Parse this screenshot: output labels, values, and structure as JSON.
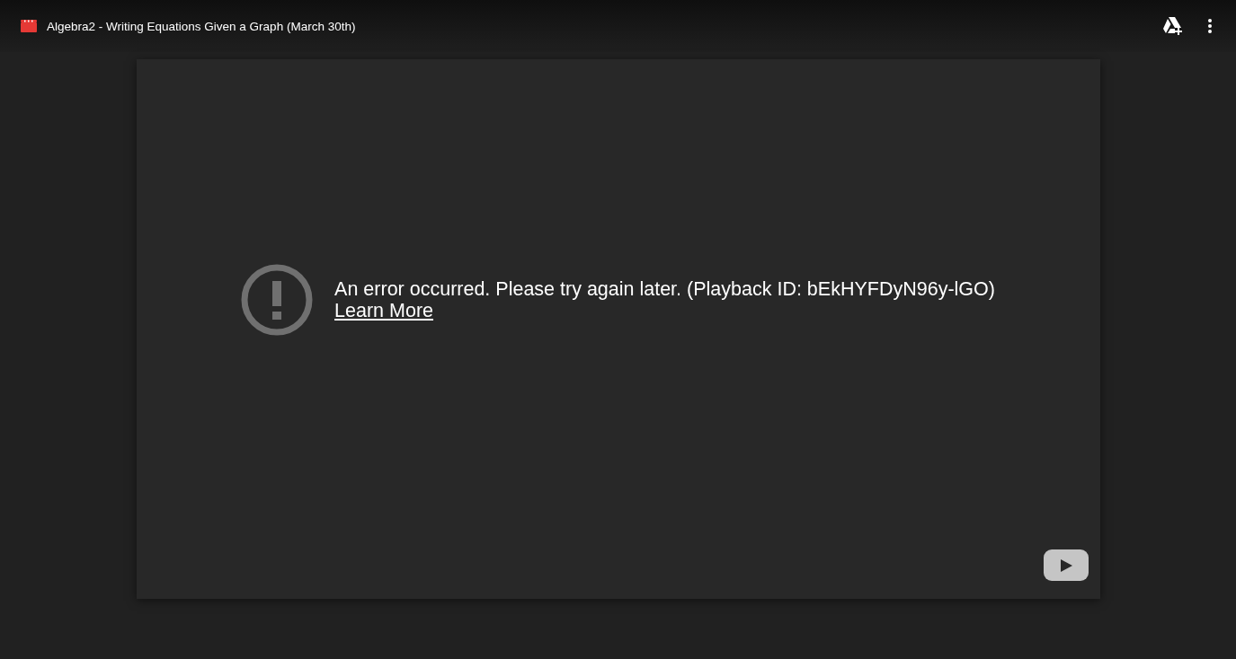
{
  "header": {
    "title": "Algebra2 - Writing Equations Given a Graph (March 30th)"
  },
  "player": {
    "error_message": "An error occurred. Please try again later. (Playback ID: bEkHYFDyN96y-lGO)",
    "link": "Learn More"
  }
}
